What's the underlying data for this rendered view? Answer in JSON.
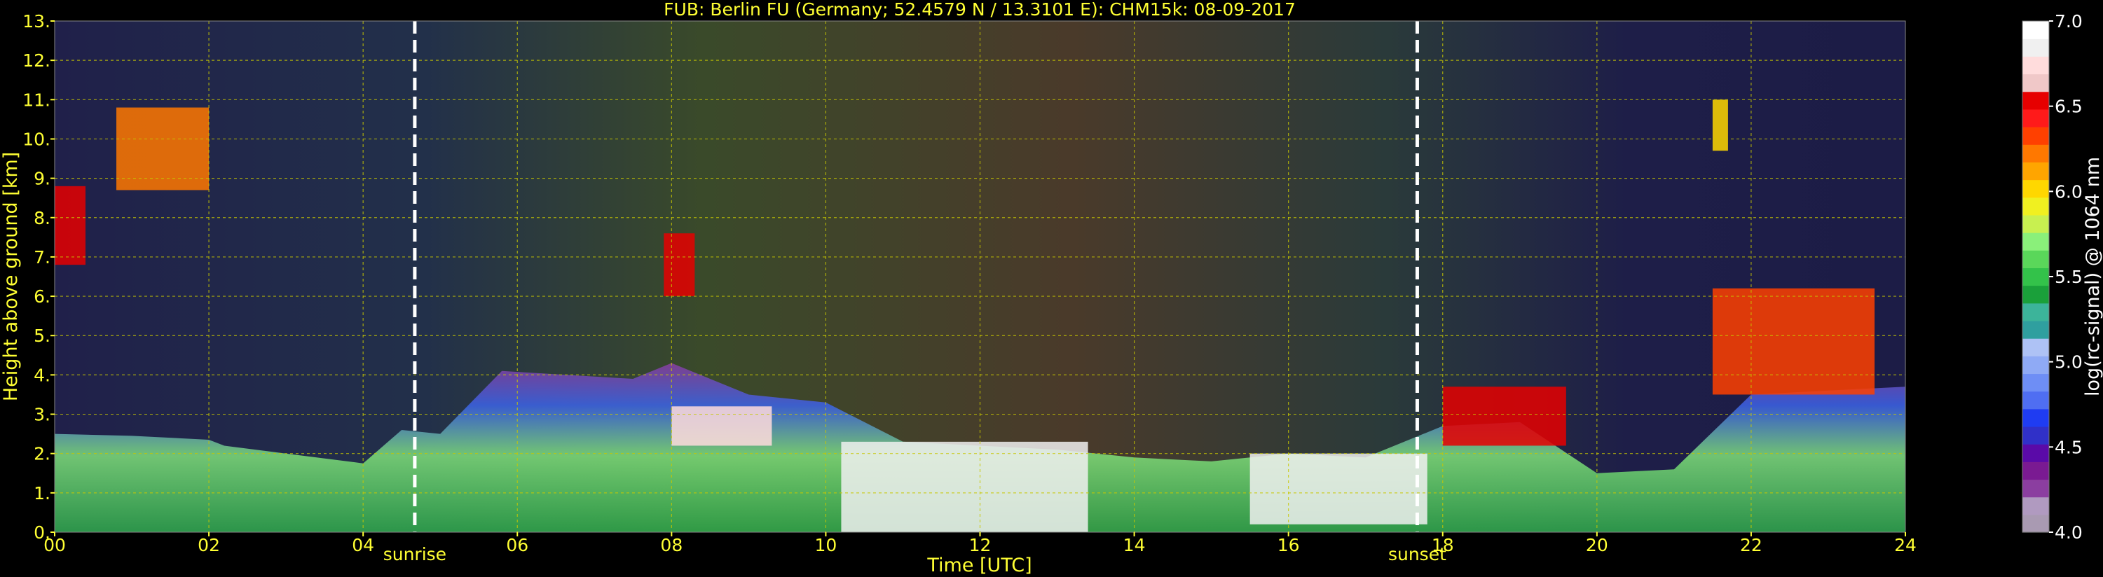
{
  "colors": {
    "text": "#ffff33",
    "cbtext": "#ffffff",
    "grid": "#c8c800",
    "marker": "#ffffff",
    "background": "#1c1c46"
  },
  "chart_data": {
    "type": "heatmap",
    "title": "FUB: Berlin FU (Germany; 52.4579 N / 13.3101 E):    CHM15k: 08-09-2017",
    "xlabel": "Time [UTC]",
    "ylabel": "Height above ground [km]",
    "xlim": [
      0,
      24
    ],
    "ylim": [
      0,
      13
    ],
    "x_ticks": [
      "00",
      "02",
      "04",
      "06",
      "08",
      "10",
      "12",
      "14",
      "16",
      "18",
      "20",
      "22",
      "24"
    ],
    "y_ticks": [
      "0.",
      "1.",
      "2.",
      "3.",
      "4.",
      "5.",
      "6.",
      "7.",
      "8.",
      "9.",
      "10.",
      "11.",
      "12.",
      "13."
    ],
    "grid": true,
    "events": [
      {
        "label": "sunrise",
        "time": 4.67
      },
      {
        "label": "sunset",
        "time": 17.67
      }
    ],
    "colorbar": {
      "label": "log(rc-signal) @ 1064 nm",
      "range": [
        4.0,
        7.0
      ],
      "ticks": [
        "4.0",
        "4.5",
        "5.0",
        "5.5",
        "6.0",
        "6.5",
        "7.0"
      ],
      "colors": [
        "#a99ab2",
        "#b09ac0",
        "#8b3ea0",
        "#7a1a92",
        "#5a0aa8",
        "#3030c8",
        "#1f3cf2",
        "#4f6ef2",
        "#6e8ef5",
        "#8faaf5",
        "#aec2f5",
        "#2f9f9f",
        "#3cb49a",
        "#1aa03a",
        "#33c24a",
        "#5ad75a",
        "#8af07a",
        "#c8f050",
        "#f0f020",
        "#ffd700",
        "#ffa500",
        "#ff7800",
        "#ff4000",
        "#ff1a1a",
        "#e60000",
        "#f0c8c8",
        "#ffdcdc",
        "#f0f0f0",
        "#ffffff"
      ]
    },
    "boundary_layer_top_km": [
      [
        0,
        2.5
      ],
      [
        1,
        2.45
      ],
      [
        2,
        2.35
      ],
      [
        2.2,
        2.2
      ],
      [
        3,
        2.0
      ],
      [
        4,
        1.75
      ],
      [
        4.5,
        2.6
      ],
      [
        5,
        2.5
      ],
      [
        5.8,
        4.1
      ],
      [
        7.5,
        3.9
      ],
      [
        8,
        4.3
      ],
      [
        9,
        3.5
      ],
      [
        10,
        3.3
      ],
      [
        11,
        2.3
      ],
      [
        12,
        2.2
      ],
      [
        13,
        2.1
      ],
      [
        14,
        1.9
      ],
      [
        15,
        1.8
      ],
      [
        16,
        2.0
      ],
      [
        17,
        1.9
      ],
      [
        18,
        2.7
      ],
      [
        19,
        2.8
      ],
      [
        20,
        1.5
      ],
      [
        21,
        1.6
      ],
      [
        22,
        3.5
      ],
      [
        23,
        3.6
      ],
      [
        24,
        3.7
      ]
    ],
    "cloud_features": [
      {
        "t0": 0.0,
        "t1": 0.4,
        "h0": 6.8,
        "h1": 8.8,
        "level": 6.6
      },
      {
        "t0": 0.8,
        "t1": 2.0,
        "h0": 8.7,
        "h1": 10.8,
        "level": 6.2
      },
      {
        "t0": 7.9,
        "t1": 8.3,
        "h0": 6.0,
        "h1": 7.6,
        "level": 6.6
      },
      {
        "t0": 8.0,
        "t1": 9.3,
        "h0": 2.2,
        "h1": 3.2,
        "level": 6.8
      },
      {
        "t0": 10.2,
        "t1": 13.4,
        "h0": 0.0,
        "h1": 2.3,
        "level": 6.9
      },
      {
        "t0": 15.5,
        "t1": 17.8,
        "h0": 0.2,
        "h1": 2.0,
        "level": 6.9
      },
      {
        "t0": 18.0,
        "t1": 19.6,
        "h0": 2.2,
        "h1": 3.7,
        "level": 6.6
      },
      {
        "t0": 21.5,
        "t1": 23.6,
        "h0": 3.5,
        "h1": 6.2,
        "level": 6.4
      },
      {
        "t0": 21.5,
        "t1": 21.7,
        "h0": 9.7,
        "h1": 11.0,
        "level": 6.0
      }
    ]
  }
}
